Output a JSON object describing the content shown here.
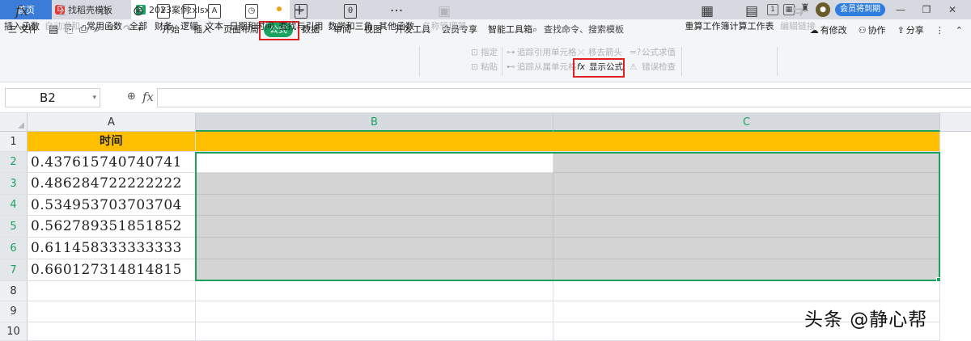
{
  "tabs": {
    "home": "首页",
    "template": "找稻壳模板",
    "file": "2023案例.xlsx",
    "add": "+"
  },
  "titlebar": {
    "member_badge": "会员将到期",
    "minimize": "—",
    "restore": "❐",
    "close": "✕"
  },
  "menu": {
    "file": "三 文件",
    "items": [
      "开始",
      "插入",
      "页面布局",
      "公式",
      "数据",
      "审阅",
      "视图",
      "开发工具",
      "会员专享",
      "智能工具箱"
    ],
    "active": "公式",
    "search": "查找命令、搜索模板",
    "right": [
      "有修改",
      "协作",
      "分享"
    ]
  },
  "ribbon": {
    "buttons": [
      {
        "label": "插入函数",
        "icon": "fx",
        "enabled": true
      },
      {
        "label": "自动求和",
        "icon": "Σ",
        "enabled": false
      },
      {
        "label": "常用函数",
        "icon": "☆",
        "enabled": true
      },
      {
        "label": "全部",
        "icon": "⊛",
        "enabled": true
      },
      {
        "label": "财务",
        "icon": "¥",
        "enabled": true
      },
      {
        "label": "逻辑",
        "icon": "?",
        "enabled": true
      },
      {
        "label": "文本",
        "icon": "A",
        "enabled": true
      },
      {
        "label": "日期和时间",
        "icon": "◷",
        "enabled": true
      },
      {
        "label": "查找与引用",
        "icon": "⌕",
        "enabled": true
      },
      {
        "label": "数学和三角",
        "icon": "θ",
        "enabled": true
      },
      {
        "label": "其他函数",
        "icon": "···",
        "enabled": true
      },
      {
        "label": "名称管理器",
        "icon": "▣",
        "enabled": false
      },
      {
        "label": "重算工作簿",
        "icon": "▦",
        "enabled": true
      },
      {
        "label": "计算工作表",
        "icon": "▤",
        "enabled": true
      },
      {
        "label": "编辑链接",
        "icon": "⇆",
        "enabled": false
      }
    ],
    "small": {
      "assign": "指定",
      "paste": "粘贴",
      "trace_precedents": "追踪引用单元格",
      "trace_dependents": "追踪从属单元格",
      "remove_arrows": "移去箭头",
      "evaluate": "公式求值",
      "show_formulas": "显示公式",
      "error_check": "错误检查"
    }
  },
  "formula_bar": {
    "name_box": "B2",
    "fx": "fx",
    "formula": ""
  },
  "sheet": {
    "columns": [
      "A",
      "B",
      "C"
    ],
    "rows": [
      "1",
      "2",
      "3",
      "4",
      "5",
      "6",
      "7",
      "8",
      "9",
      "10"
    ],
    "header": "时间",
    "values": [
      "0.437615740740741",
      "0.486284722222222",
      "0.534953703703704",
      "0.562789351851852",
      "0.611458333333333",
      "0.660127314814815"
    ]
  },
  "watermark": "头条 @静心帮"
}
